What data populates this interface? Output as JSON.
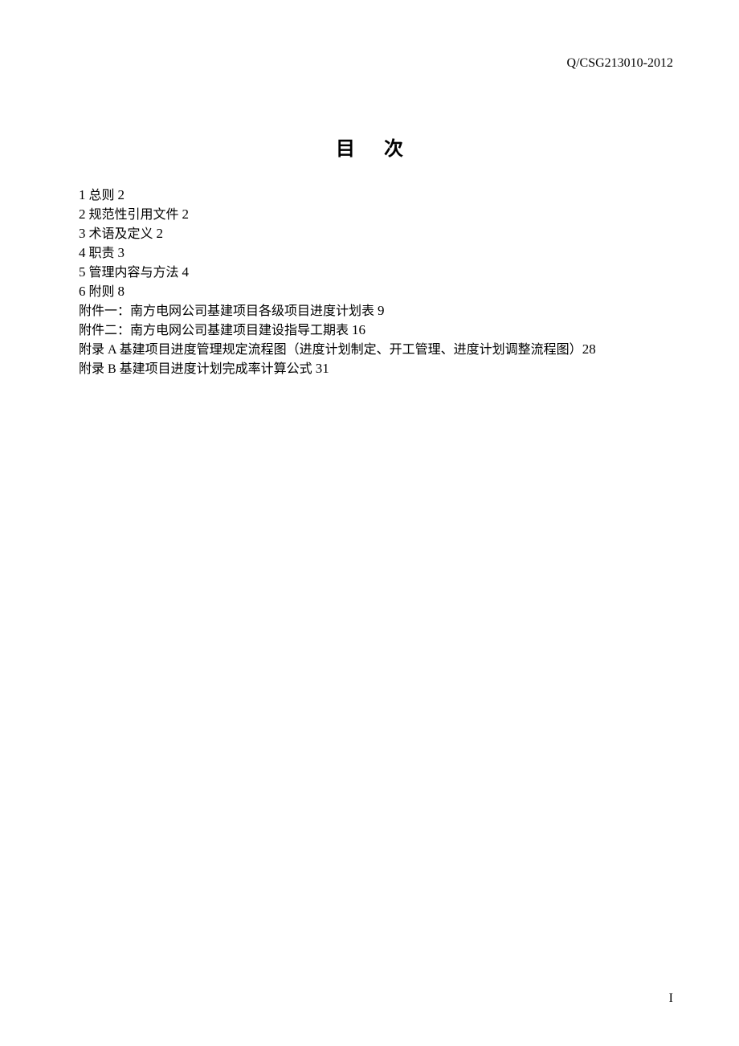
{
  "header_code": "Q/CSG213010-2012",
  "title": "目次",
  "toc": [
    {
      "num": "1",
      "text": " 总则 ",
      "page": "2"
    },
    {
      "num": "2",
      "text": " 规范性引用文件 ",
      "page": "2"
    },
    {
      "num": "3",
      "text": " 术语及定义 ",
      "page": "2"
    },
    {
      "num": "4",
      "text": " 职责 ",
      "page": "3"
    },
    {
      "num": "5",
      "text": " 管理内容与方法 ",
      "page": "4"
    },
    {
      "num": "6",
      "text": " 附则 ",
      "page": "8"
    },
    {
      "num": "",
      "text": "附件一：南方电网公司基建项目各级项目进度计划表 ",
      "page": "9"
    },
    {
      "num": "",
      "text": "附件二：南方电网公司基建项目建设指导工期表 ",
      "page": "16"
    },
    {
      "num": "",
      "text": "附录 A  基建项目进度管理规定流程图（进度计划制定、开工管理、进度计划调整流程图）",
      "page": "28"
    },
    {
      "num": "",
      "text": "附录 B  基建项目进度计划完成率计算公式 ",
      "page": "31"
    }
  ],
  "page_number": "I"
}
